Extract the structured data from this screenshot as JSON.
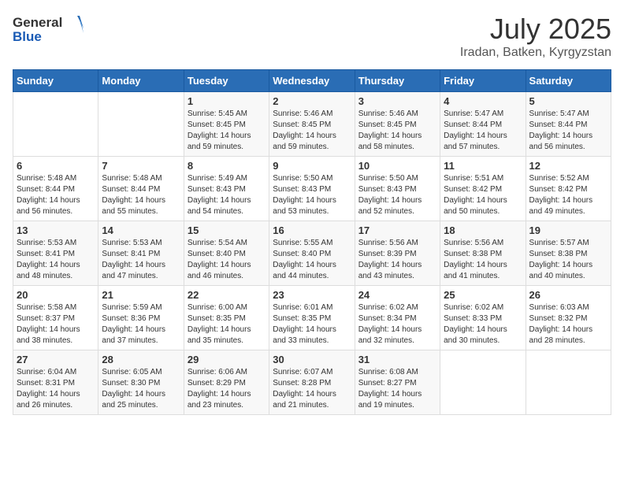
{
  "header": {
    "logo_general": "General",
    "logo_blue": "Blue",
    "month_title": "July 2025",
    "location": "Iradan, Batken, Kyrgyzstan"
  },
  "days_of_week": [
    "Sunday",
    "Monday",
    "Tuesday",
    "Wednesday",
    "Thursday",
    "Friday",
    "Saturday"
  ],
  "weeks": [
    [
      {
        "day": "",
        "sunrise": "",
        "sunset": "",
        "daylight": ""
      },
      {
        "day": "",
        "sunrise": "",
        "sunset": "",
        "daylight": ""
      },
      {
        "day": "1",
        "sunrise": "Sunrise: 5:45 AM",
        "sunset": "Sunset: 8:45 PM",
        "daylight": "Daylight: 14 hours and 59 minutes."
      },
      {
        "day": "2",
        "sunrise": "Sunrise: 5:46 AM",
        "sunset": "Sunset: 8:45 PM",
        "daylight": "Daylight: 14 hours and 59 minutes."
      },
      {
        "day": "3",
        "sunrise": "Sunrise: 5:46 AM",
        "sunset": "Sunset: 8:45 PM",
        "daylight": "Daylight: 14 hours and 58 minutes."
      },
      {
        "day": "4",
        "sunrise": "Sunrise: 5:47 AM",
        "sunset": "Sunset: 8:44 PM",
        "daylight": "Daylight: 14 hours and 57 minutes."
      },
      {
        "day": "5",
        "sunrise": "Sunrise: 5:47 AM",
        "sunset": "Sunset: 8:44 PM",
        "daylight": "Daylight: 14 hours and 56 minutes."
      }
    ],
    [
      {
        "day": "6",
        "sunrise": "Sunrise: 5:48 AM",
        "sunset": "Sunset: 8:44 PM",
        "daylight": "Daylight: 14 hours and 56 minutes."
      },
      {
        "day": "7",
        "sunrise": "Sunrise: 5:48 AM",
        "sunset": "Sunset: 8:44 PM",
        "daylight": "Daylight: 14 hours and 55 minutes."
      },
      {
        "day": "8",
        "sunrise": "Sunrise: 5:49 AM",
        "sunset": "Sunset: 8:43 PM",
        "daylight": "Daylight: 14 hours and 54 minutes."
      },
      {
        "day": "9",
        "sunrise": "Sunrise: 5:50 AM",
        "sunset": "Sunset: 8:43 PM",
        "daylight": "Daylight: 14 hours and 53 minutes."
      },
      {
        "day": "10",
        "sunrise": "Sunrise: 5:50 AM",
        "sunset": "Sunset: 8:43 PM",
        "daylight": "Daylight: 14 hours and 52 minutes."
      },
      {
        "day": "11",
        "sunrise": "Sunrise: 5:51 AM",
        "sunset": "Sunset: 8:42 PM",
        "daylight": "Daylight: 14 hours and 50 minutes."
      },
      {
        "day": "12",
        "sunrise": "Sunrise: 5:52 AM",
        "sunset": "Sunset: 8:42 PM",
        "daylight": "Daylight: 14 hours and 49 minutes."
      }
    ],
    [
      {
        "day": "13",
        "sunrise": "Sunrise: 5:53 AM",
        "sunset": "Sunset: 8:41 PM",
        "daylight": "Daylight: 14 hours and 48 minutes."
      },
      {
        "day": "14",
        "sunrise": "Sunrise: 5:53 AM",
        "sunset": "Sunset: 8:41 PM",
        "daylight": "Daylight: 14 hours and 47 minutes."
      },
      {
        "day": "15",
        "sunrise": "Sunrise: 5:54 AM",
        "sunset": "Sunset: 8:40 PM",
        "daylight": "Daylight: 14 hours and 46 minutes."
      },
      {
        "day": "16",
        "sunrise": "Sunrise: 5:55 AM",
        "sunset": "Sunset: 8:40 PM",
        "daylight": "Daylight: 14 hours and 44 minutes."
      },
      {
        "day": "17",
        "sunrise": "Sunrise: 5:56 AM",
        "sunset": "Sunset: 8:39 PM",
        "daylight": "Daylight: 14 hours and 43 minutes."
      },
      {
        "day": "18",
        "sunrise": "Sunrise: 5:56 AM",
        "sunset": "Sunset: 8:38 PM",
        "daylight": "Daylight: 14 hours and 41 minutes."
      },
      {
        "day": "19",
        "sunrise": "Sunrise: 5:57 AM",
        "sunset": "Sunset: 8:38 PM",
        "daylight": "Daylight: 14 hours and 40 minutes."
      }
    ],
    [
      {
        "day": "20",
        "sunrise": "Sunrise: 5:58 AM",
        "sunset": "Sunset: 8:37 PM",
        "daylight": "Daylight: 14 hours and 38 minutes."
      },
      {
        "day": "21",
        "sunrise": "Sunrise: 5:59 AM",
        "sunset": "Sunset: 8:36 PM",
        "daylight": "Daylight: 14 hours and 37 minutes."
      },
      {
        "day": "22",
        "sunrise": "Sunrise: 6:00 AM",
        "sunset": "Sunset: 8:35 PM",
        "daylight": "Daylight: 14 hours and 35 minutes."
      },
      {
        "day": "23",
        "sunrise": "Sunrise: 6:01 AM",
        "sunset": "Sunset: 8:35 PM",
        "daylight": "Daylight: 14 hours and 33 minutes."
      },
      {
        "day": "24",
        "sunrise": "Sunrise: 6:02 AM",
        "sunset": "Sunset: 8:34 PM",
        "daylight": "Daylight: 14 hours and 32 minutes."
      },
      {
        "day": "25",
        "sunrise": "Sunrise: 6:02 AM",
        "sunset": "Sunset: 8:33 PM",
        "daylight": "Daylight: 14 hours and 30 minutes."
      },
      {
        "day": "26",
        "sunrise": "Sunrise: 6:03 AM",
        "sunset": "Sunset: 8:32 PM",
        "daylight": "Daylight: 14 hours and 28 minutes."
      }
    ],
    [
      {
        "day": "27",
        "sunrise": "Sunrise: 6:04 AM",
        "sunset": "Sunset: 8:31 PM",
        "daylight": "Daylight: 14 hours and 26 minutes."
      },
      {
        "day": "28",
        "sunrise": "Sunrise: 6:05 AM",
        "sunset": "Sunset: 8:30 PM",
        "daylight": "Daylight: 14 hours and 25 minutes."
      },
      {
        "day": "29",
        "sunrise": "Sunrise: 6:06 AM",
        "sunset": "Sunset: 8:29 PM",
        "daylight": "Daylight: 14 hours and 23 minutes."
      },
      {
        "day": "30",
        "sunrise": "Sunrise: 6:07 AM",
        "sunset": "Sunset: 8:28 PM",
        "daylight": "Daylight: 14 hours and 21 minutes."
      },
      {
        "day": "31",
        "sunrise": "Sunrise: 6:08 AM",
        "sunset": "Sunset: 8:27 PM",
        "daylight": "Daylight: 14 hours and 19 minutes."
      },
      {
        "day": "",
        "sunrise": "",
        "sunset": "",
        "daylight": ""
      },
      {
        "day": "",
        "sunrise": "",
        "sunset": "",
        "daylight": ""
      }
    ]
  ]
}
